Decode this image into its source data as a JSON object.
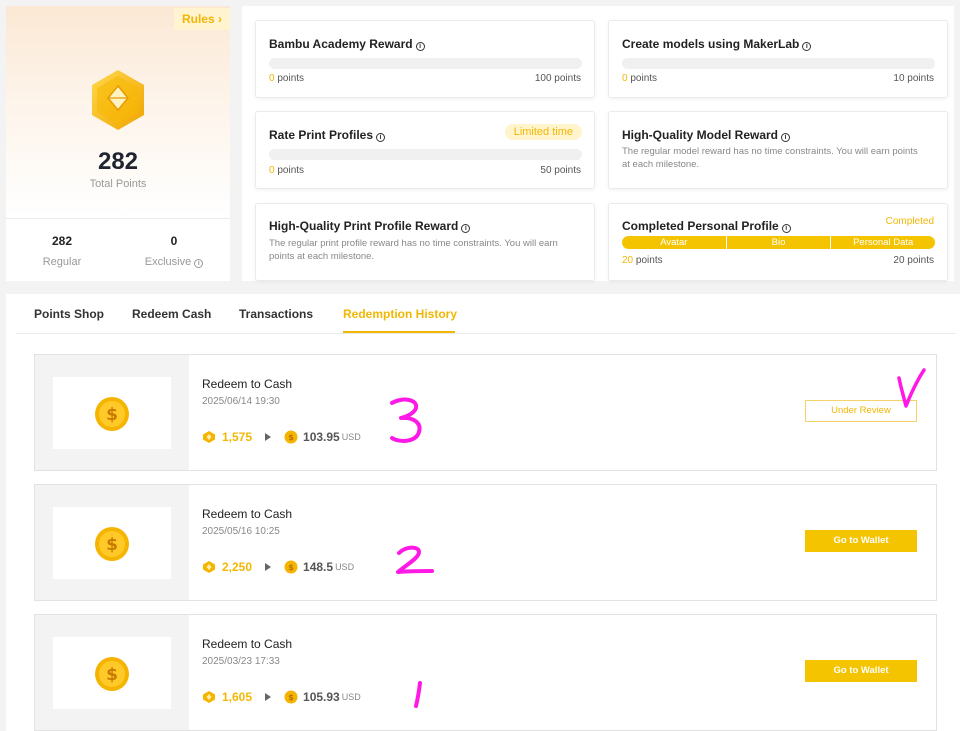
{
  "points_summary": {
    "rules_label": "Rules",
    "total_value": "282",
    "total_label": "Total Points",
    "regular_value": "282",
    "regular_label": "Regular",
    "exclusive_value": "0",
    "exclusive_label": "Exclusive"
  },
  "tasks": [
    {
      "title": "Bambu Academy Reward",
      "current": "0",
      "current_unit": "points",
      "target": "100 points"
    },
    {
      "title": "Create models using MakerLab",
      "current": "0",
      "current_unit": "points",
      "target": "10 points"
    },
    {
      "title": "Rate Print Profiles",
      "badge": "Limited time",
      "current": "0",
      "current_unit": "points",
      "target": "50 points"
    },
    {
      "title": "High-Quality Model Reward",
      "description": "The regular model reward has no time constraints. You will earn points at each milestone."
    },
    {
      "title": "High-Quality Print Profile Reward",
      "description": "The regular print profile reward has no time constraints. You will earn points at each milestone."
    },
    {
      "title": "Completed Personal Profile",
      "status": "Completed",
      "segments": [
        "Avatar",
        "Bio",
        "Personal Data"
      ],
      "current": "20",
      "current_unit": "points",
      "target": "20 points"
    }
  ],
  "tabs": [
    {
      "label": "Points Shop",
      "active": false
    },
    {
      "label": "Redeem Cash",
      "active": false
    },
    {
      "label": "Transactions",
      "active": false
    },
    {
      "label": "Redemption History",
      "active": true
    }
  ],
  "redemptions": [
    {
      "title": "Redeem to Cash",
      "date": "2025/06/14 19:30",
      "points": "1,575",
      "cash": "103.95",
      "currency": "USD",
      "action": "Under Review",
      "annotation": "3"
    },
    {
      "title": "Redeem to Cash",
      "date": "2025/05/16 10:25",
      "points": "2,250",
      "cash": "148.5",
      "currency": "USD",
      "action": "Go to Wallet",
      "annotation": "2"
    },
    {
      "title": "Redeem to Cash",
      "date": "2025/03/23 17:33",
      "points": "1,605",
      "cash": "105.93",
      "currency": "USD",
      "action": "Go to Wallet",
      "annotation": "1"
    }
  ],
  "colors": {
    "accent": "#f2b705",
    "accent_fill": "#f5c400",
    "annotation": "#ff19e6"
  }
}
